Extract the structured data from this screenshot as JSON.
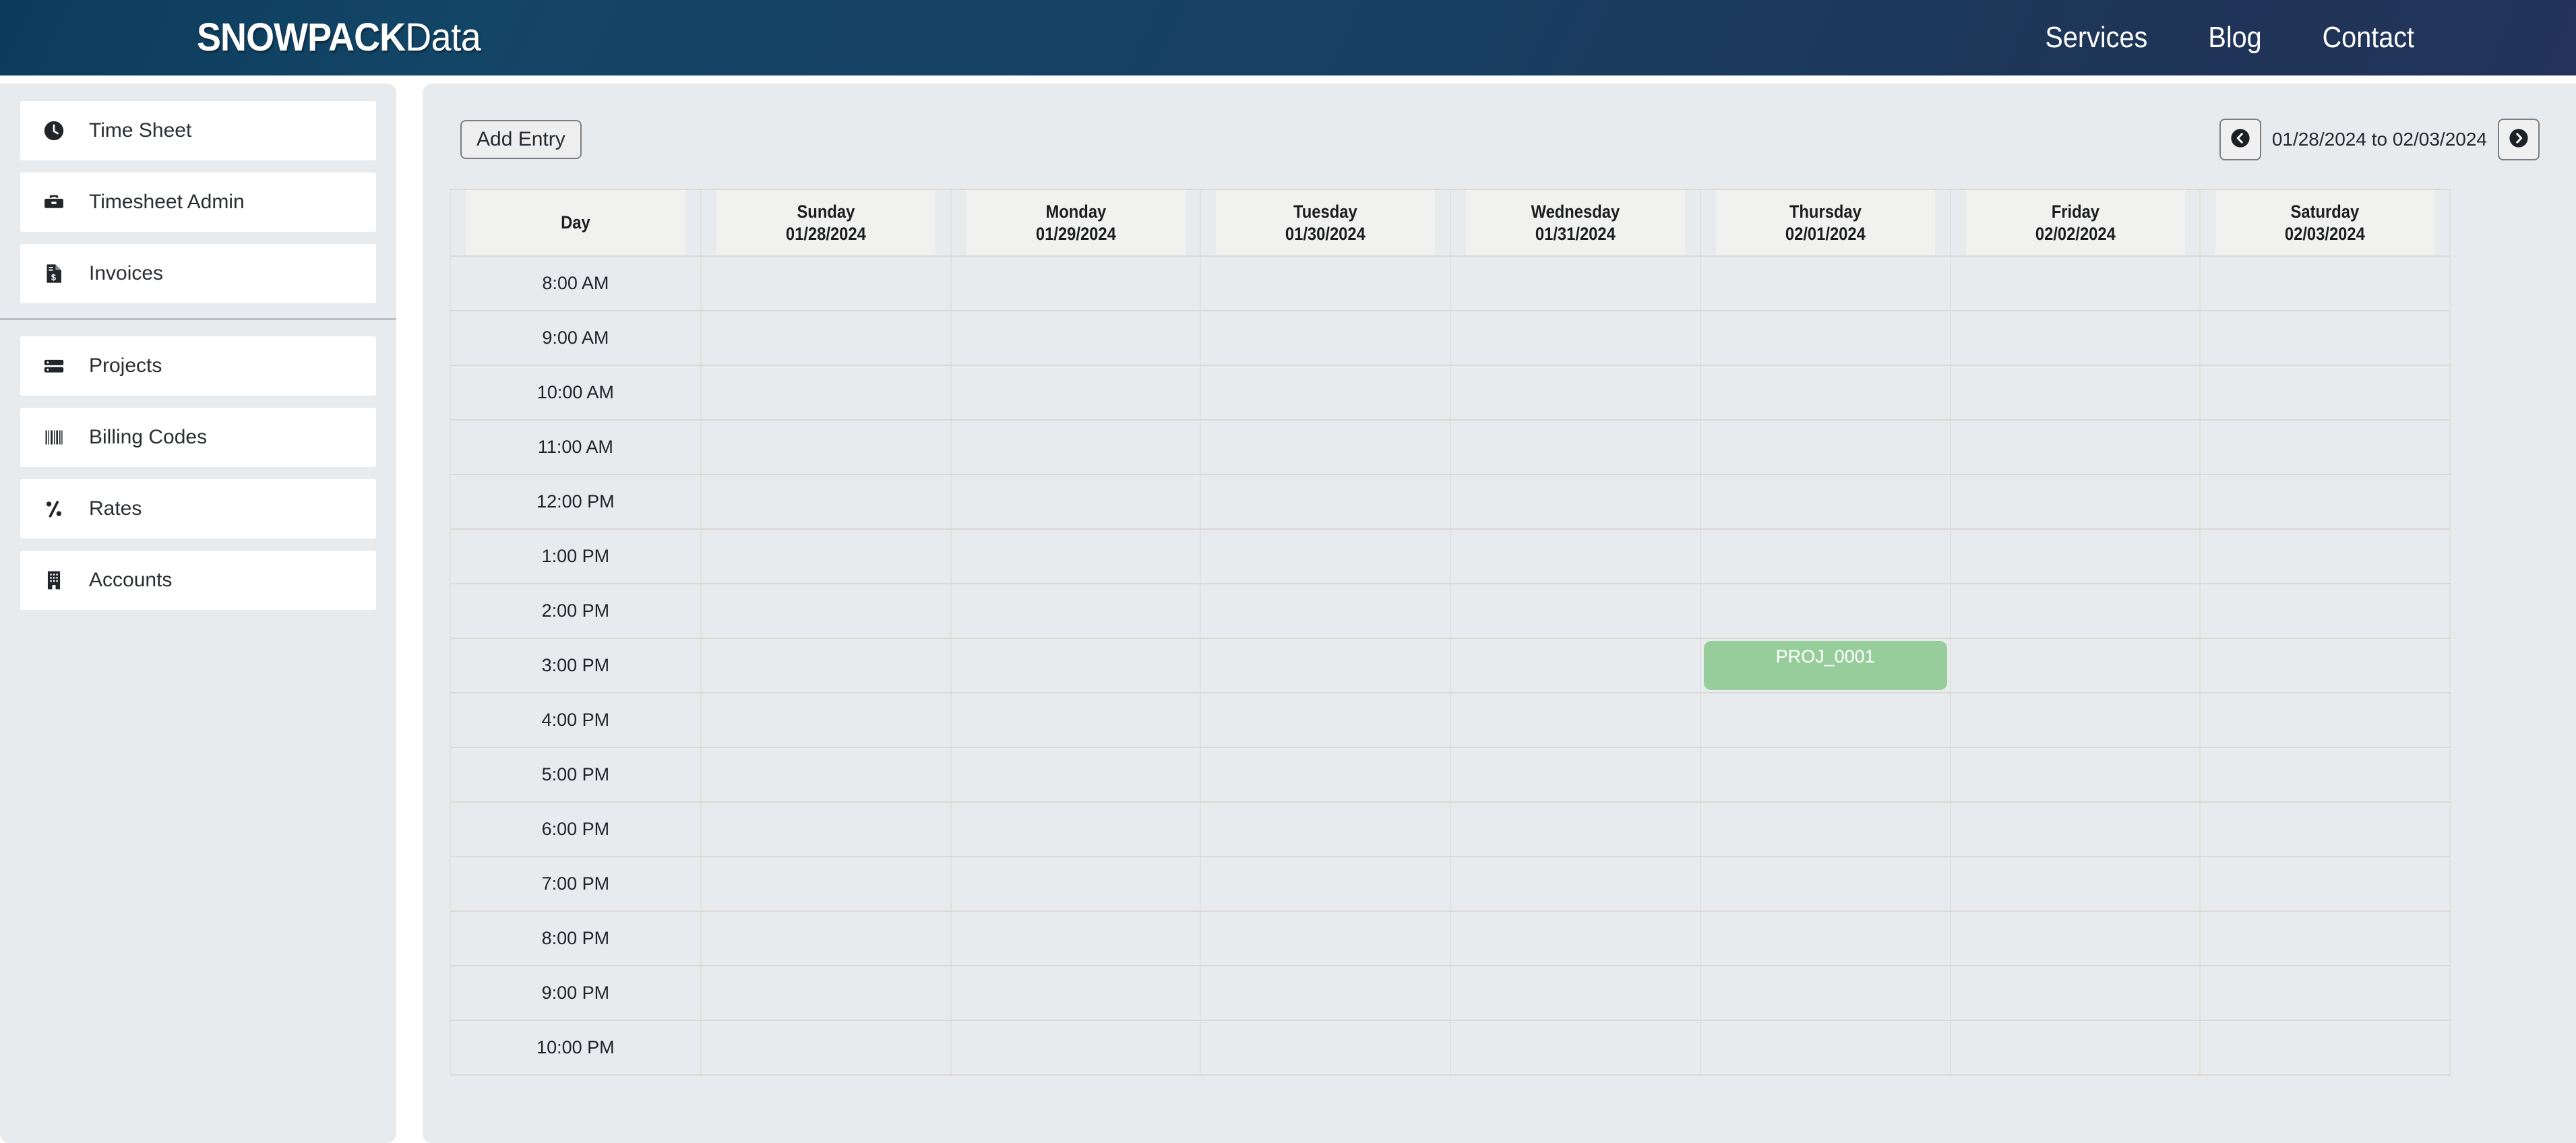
{
  "header": {
    "brand_bold": "SNOWPACK",
    "brand_light": "Data",
    "nav": [
      {
        "label": "Services"
      },
      {
        "label": "Blog"
      },
      {
        "label": "Contact"
      }
    ]
  },
  "sidebar": {
    "group_one": [
      {
        "label": "Time Sheet",
        "icon": "clock-icon"
      },
      {
        "label": "Timesheet Admin",
        "icon": "toolbox-icon"
      },
      {
        "label": "Invoices",
        "icon": "invoice-icon"
      }
    ],
    "group_two": [
      {
        "label": "Projects",
        "icon": "server-stack-icon"
      },
      {
        "label": "Billing Codes",
        "icon": "barcode-icon"
      },
      {
        "label": "Rates",
        "icon": "percent-icon"
      },
      {
        "label": "Accounts",
        "icon": "building-icon"
      }
    ]
  },
  "toolbar": {
    "add_entry_label": "Add Entry",
    "date_range": "01/28/2024 to 02/03/2024",
    "prev_icon": "chevron-left-circle-icon",
    "next_icon": "chevron-right-circle-icon"
  },
  "timesheet": {
    "day_header": "Day",
    "columns": [
      {
        "dow": "Sunday",
        "date": "01/28/2024"
      },
      {
        "dow": "Monday",
        "date": "01/29/2024"
      },
      {
        "dow": "Tuesday",
        "date": "01/30/2024"
      },
      {
        "dow": "Wednesday",
        "date": "01/31/2024"
      },
      {
        "dow": "Thursday",
        "date": "02/01/2024"
      },
      {
        "dow": "Friday",
        "date": "02/02/2024"
      },
      {
        "dow": "Saturday",
        "date": "02/03/2024"
      }
    ],
    "times": [
      "8:00 AM",
      "9:00 AM",
      "10:00 AM",
      "11:00 AM",
      "12:00 PM",
      "1:00 PM",
      "2:00 PM",
      "3:00 PM",
      "4:00 PM",
      "5:00 PM",
      "6:00 PM",
      "7:00 PM",
      "8:00 PM",
      "9:00 PM",
      "10:00 PM"
    ],
    "entries": [
      {
        "label": "PROJ_0001",
        "time": "3:00 PM",
        "day_index": 4,
        "color": "#97cd9b"
      }
    ]
  }
}
